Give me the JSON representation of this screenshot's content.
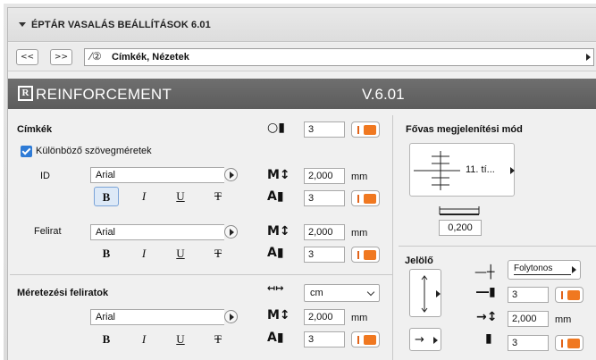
{
  "title": "ÉPTÁR VASALÁS BEÁLLÍTÁSOK 6.01",
  "nav": {
    "prev": "<<",
    "next": ">>",
    "page_icon": "⁄②",
    "page_label": "Címkék, Nézetek"
  },
  "banner": {
    "logo": "R",
    "name": "REINFORCEMENT",
    "version": "V.6.01"
  },
  "labels_section": {
    "title": "Címkék",
    "count_value": "3",
    "diff_sizes_label": "Különböző szövegméretek",
    "diff_sizes_checked": true,
    "id": {
      "label": "ID",
      "font": "Arial",
      "height": "2,000",
      "height_unit": "mm",
      "pen": "3",
      "bold_active": true
    },
    "felirat": {
      "label": "Felirat",
      "font": "Arial",
      "height": "2,000",
      "height_unit": "mm",
      "pen": "3"
    }
  },
  "dimension_section": {
    "title": "Méretezési feliratok",
    "unit_select": "cm",
    "font": "Arial",
    "height": "2,000",
    "height_unit": "mm",
    "pen": "3"
  },
  "style_buttons": {
    "bold": "B",
    "italic": "I",
    "underline": "U",
    "strike": "T"
  },
  "main_bar_mode": {
    "title": "Fővas megjelenítési mód",
    "preview_label": "11. tí...",
    "offset_value": "0,200"
  },
  "marker": {
    "title": "Jelölő",
    "line_type": "Folytonos",
    "pen": "3",
    "size": "2,000",
    "size_unit": "mm",
    "pen2": "3"
  },
  "colors": {
    "accent": "#f07820",
    "banner": "#666666",
    "checkbox": "#2e7bd6"
  }
}
